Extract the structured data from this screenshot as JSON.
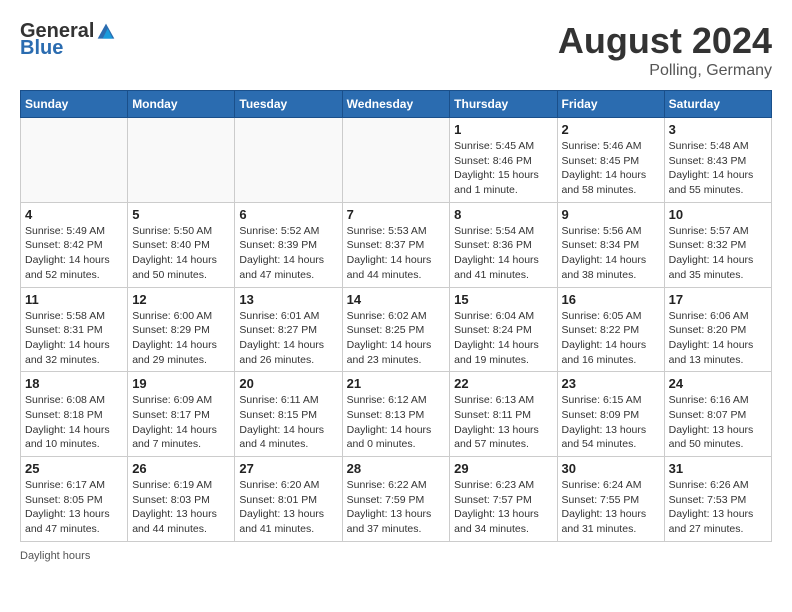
{
  "header": {
    "logo_general": "General",
    "logo_blue": "Blue",
    "month_title": "August 2024",
    "location": "Polling, Germany"
  },
  "days_of_week": [
    "Sunday",
    "Monday",
    "Tuesday",
    "Wednesday",
    "Thursday",
    "Friday",
    "Saturday"
  ],
  "footer": {
    "daylight_hours": "Daylight hours"
  },
  "weeks": [
    [
      {
        "day": "",
        "info": ""
      },
      {
        "day": "",
        "info": ""
      },
      {
        "day": "",
        "info": ""
      },
      {
        "day": "",
        "info": ""
      },
      {
        "day": "1",
        "info": "Sunrise: 5:45 AM\nSunset: 8:46 PM\nDaylight: 15 hours\nand 1 minute."
      },
      {
        "day": "2",
        "info": "Sunrise: 5:46 AM\nSunset: 8:45 PM\nDaylight: 14 hours\nand 58 minutes."
      },
      {
        "day": "3",
        "info": "Sunrise: 5:48 AM\nSunset: 8:43 PM\nDaylight: 14 hours\nand 55 minutes."
      }
    ],
    [
      {
        "day": "4",
        "info": "Sunrise: 5:49 AM\nSunset: 8:42 PM\nDaylight: 14 hours\nand 52 minutes."
      },
      {
        "day": "5",
        "info": "Sunrise: 5:50 AM\nSunset: 8:40 PM\nDaylight: 14 hours\nand 50 minutes."
      },
      {
        "day": "6",
        "info": "Sunrise: 5:52 AM\nSunset: 8:39 PM\nDaylight: 14 hours\nand 47 minutes."
      },
      {
        "day": "7",
        "info": "Sunrise: 5:53 AM\nSunset: 8:37 PM\nDaylight: 14 hours\nand 44 minutes."
      },
      {
        "day": "8",
        "info": "Sunrise: 5:54 AM\nSunset: 8:36 PM\nDaylight: 14 hours\nand 41 minutes."
      },
      {
        "day": "9",
        "info": "Sunrise: 5:56 AM\nSunset: 8:34 PM\nDaylight: 14 hours\nand 38 minutes."
      },
      {
        "day": "10",
        "info": "Sunrise: 5:57 AM\nSunset: 8:32 PM\nDaylight: 14 hours\nand 35 minutes."
      }
    ],
    [
      {
        "day": "11",
        "info": "Sunrise: 5:58 AM\nSunset: 8:31 PM\nDaylight: 14 hours\nand 32 minutes."
      },
      {
        "day": "12",
        "info": "Sunrise: 6:00 AM\nSunset: 8:29 PM\nDaylight: 14 hours\nand 29 minutes."
      },
      {
        "day": "13",
        "info": "Sunrise: 6:01 AM\nSunset: 8:27 PM\nDaylight: 14 hours\nand 26 minutes."
      },
      {
        "day": "14",
        "info": "Sunrise: 6:02 AM\nSunset: 8:25 PM\nDaylight: 14 hours\nand 23 minutes."
      },
      {
        "day": "15",
        "info": "Sunrise: 6:04 AM\nSunset: 8:24 PM\nDaylight: 14 hours\nand 19 minutes."
      },
      {
        "day": "16",
        "info": "Sunrise: 6:05 AM\nSunset: 8:22 PM\nDaylight: 14 hours\nand 16 minutes."
      },
      {
        "day": "17",
        "info": "Sunrise: 6:06 AM\nSunset: 8:20 PM\nDaylight: 14 hours\nand 13 minutes."
      }
    ],
    [
      {
        "day": "18",
        "info": "Sunrise: 6:08 AM\nSunset: 8:18 PM\nDaylight: 14 hours\nand 10 minutes."
      },
      {
        "day": "19",
        "info": "Sunrise: 6:09 AM\nSunset: 8:17 PM\nDaylight: 14 hours\nand 7 minutes."
      },
      {
        "day": "20",
        "info": "Sunrise: 6:11 AM\nSunset: 8:15 PM\nDaylight: 14 hours\nand 4 minutes."
      },
      {
        "day": "21",
        "info": "Sunrise: 6:12 AM\nSunset: 8:13 PM\nDaylight: 14 hours\nand 0 minutes."
      },
      {
        "day": "22",
        "info": "Sunrise: 6:13 AM\nSunset: 8:11 PM\nDaylight: 13 hours\nand 57 minutes."
      },
      {
        "day": "23",
        "info": "Sunrise: 6:15 AM\nSunset: 8:09 PM\nDaylight: 13 hours\nand 54 minutes."
      },
      {
        "day": "24",
        "info": "Sunrise: 6:16 AM\nSunset: 8:07 PM\nDaylight: 13 hours\nand 50 minutes."
      }
    ],
    [
      {
        "day": "25",
        "info": "Sunrise: 6:17 AM\nSunset: 8:05 PM\nDaylight: 13 hours\nand 47 minutes."
      },
      {
        "day": "26",
        "info": "Sunrise: 6:19 AM\nSunset: 8:03 PM\nDaylight: 13 hours\nand 44 minutes."
      },
      {
        "day": "27",
        "info": "Sunrise: 6:20 AM\nSunset: 8:01 PM\nDaylight: 13 hours\nand 41 minutes."
      },
      {
        "day": "28",
        "info": "Sunrise: 6:22 AM\nSunset: 7:59 PM\nDaylight: 13 hours\nand 37 minutes."
      },
      {
        "day": "29",
        "info": "Sunrise: 6:23 AM\nSunset: 7:57 PM\nDaylight: 13 hours\nand 34 minutes."
      },
      {
        "day": "30",
        "info": "Sunrise: 6:24 AM\nSunset: 7:55 PM\nDaylight: 13 hours\nand 31 minutes."
      },
      {
        "day": "31",
        "info": "Sunrise: 6:26 AM\nSunset: 7:53 PM\nDaylight: 13 hours\nand 27 minutes."
      }
    ]
  ]
}
